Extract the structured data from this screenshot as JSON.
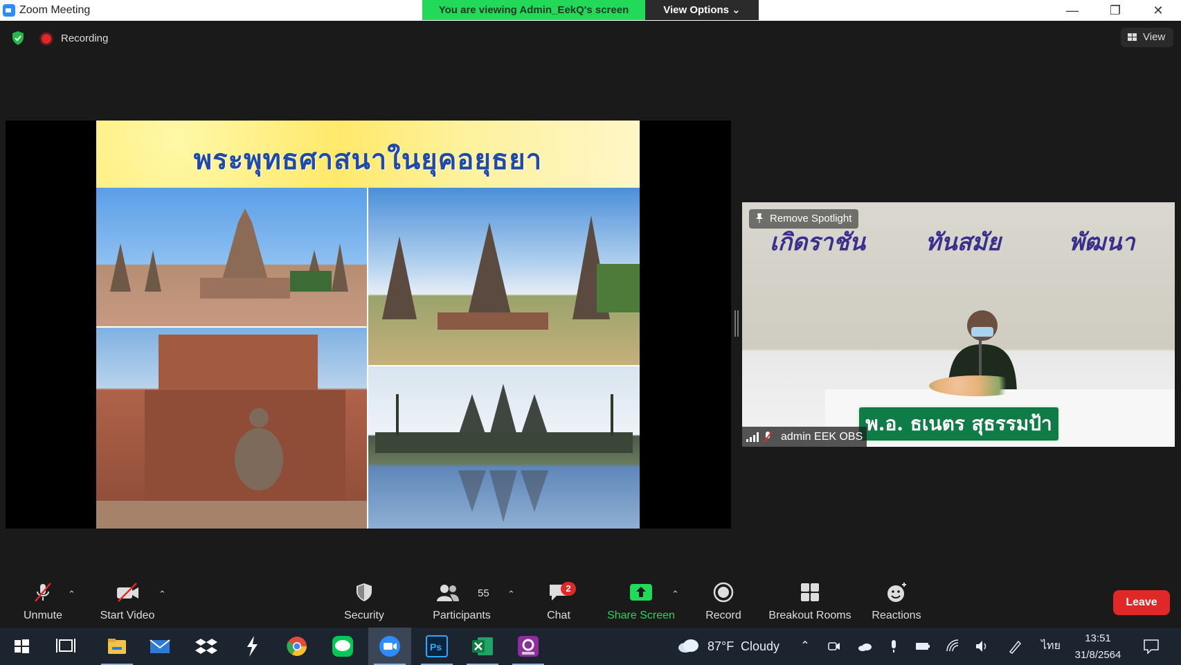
{
  "window": {
    "title": "Zoom Meeting",
    "minimize": "—",
    "restore": "❐",
    "close": "✕"
  },
  "share_banner": {
    "viewing_text": "You are viewing Admin_EekQ's screen",
    "view_options_label": "View Options ⌄"
  },
  "status": {
    "recording_label": "Recording",
    "view_label": "View"
  },
  "slide": {
    "title": "พระพุทธศาสนาในยุคอยุธยา"
  },
  "video": {
    "banner_words": [
      "เกิดราชัน",
      "ทันสมัย",
      "พัฒนา"
    ],
    "remove_spotlight_label": "Remove Spotlight",
    "nameplate_text": "พ.อ. ธเนตร สุธรรมป้า",
    "participant_name": "admin EEK OBS"
  },
  "toolbar": {
    "unmute_label": "Unmute",
    "start_video_label": "Start Video",
    "security_label": "Security",
    "participants_label": "Participants",
    "participants_count": "55",
    "chat_label": "Chat",
    "chat_badge": "2",
    "share_screen_label": "Share Screen",
    "record_label": "Record",
    "breakout_rooms_label": "Breakout Rooms",
    "reactions_label": "Reactions",
    "leave_label": "Leave",
    "caret": "⌃",
    "accent_green": "#23d959",
    "leave_red": "#e02828"
  },
  "taskbar": {
    "weather_temp": "87°F",
    "weather_text": "Cloudy",
    "language": "ไทย",
    "time": "13:51",
    "date": "31/8/2564"
  }
}
